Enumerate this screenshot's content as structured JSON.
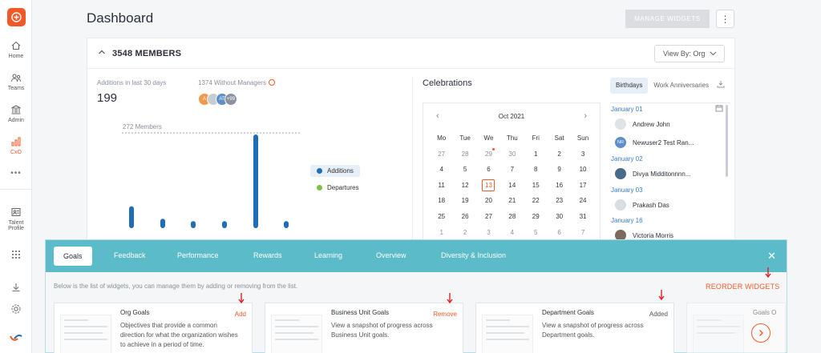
{
  "sidebar": {
    "items": [
      {
        "label": "Home",
        "icon": "home-icon"
      },
      {
        "label": "Teams",
        "icon": "teams-icon"
      },
      {
        "label": "Admin",
        "icon": "admin-icon"
      },
      {
        "label": "CxO",
        "icon": "cxo-icon"
      },
      {
        "label": "Talent Profile",
        "icon": "talent-profile-icon"
      }
    ],
    "more": "•••"
  },
  "header": {
    "title": "Dashboard",
    "manage_widgets": "MANAGE WIDGETS",
    "kebab": "⋮"
  },
  "members": {
    "title": "3548 MEMBERS",
    "view_by": "View By: Org",
    "additions_label": "Additions in last 30 days",
    "additions_value": "199",
    "without_managers": "1374 Without Managers",
    "avatars": [
      "A",
      "",
      "AT",
      "+99"
    ]
  },
  "chart_data": {
    "type": "bar",
    "reference_line_label": "272 Members",
    "series": [
      {
        "name": "Additions",
        "color": "#1f6db5",
        "values": [
          28,
          12,
          9,
          9,
          120,
          9
        ]
      },
      {
        "name": "Departures",
        "color": "#7cc244",
        "values": [
          0,
          0,
          0,
          0,
          0,
          0
        ]
      }
    ]
  },
  "celebrations": {
    "title": "Celebrations",
    "tabs": [
      "Birthdays",
      "Work Anniversaries"
    ],
    "calendar": {
      "month": "Oct 2021",
      "dow": [
        "Mo",
        "Tue",
        "We",
        "Thu",
        "Fri",
        "Sat",
        "Sun"
      ],
      "weeks": [
        [
          "27",
          "28",
          "29",
          "30",
          "1",
          "2",
          "3"
        ],
        [
          "4",
          "5",
          "6",
          "7",
          "8",
          "9",
          "10"
        ],
        [
          "11",
          "12",
          "13",
          "14",
          "15",
          "16",
          "17"
        ],
        [
          "18",
          "19",
          "20",
          "21",
          "22",
          "23",
          "24"
        ],
        [
          "25",
          "26",
          "27",
          "28",
          "29",
          "30",
          "31"
        ],
        [
          "1",
          "2",
          "3",
          "4",
          "5",
          "6",
          "7"
        ]
      ],
      "today": "13"
    },
    "birthdays": [
      {
        "date": "January 01",
        "people": [
          {
            "name": "Andrew John",
            "initials": ""
          },
          {
            "name": "Newuser2 Test Ran...",
            "initials": "NR"
          }
        ]
      },
      {
        "date": "January 02",
        "people": [
          {
            "name": "Divya Midditonnnn...",
            "initials": ""
          }
        ]
      },
      {
        "date": "January 03",
        "people": [
          {
            "name": "Prakash Das",
            "initials": ""
          }
        ]
      },
      {
        "date": "January 16",
        "people": [
          {
            "name": "Victoria Morris",
            "initials": ""
          }
        ]
      }
    ]
  },
  "widget_manager": {
    "tabs": [
      "Goals",
      "Feedback",
      "Performance",
      "Rewards",
      "Learning",
      "Overview",
      "Diversity & Inclusion"
    ],
    "close": "✕",
    "description": "Below is the list of widgets, you can manage them by adding or removing from the list.",
    "reorder": "REORDER WIDGETS",
    "cards": [
      {
        "title": "Org Goals",
        "description": "Objectives that provide a common direction for what the organization wishes to achieve in a period of time.",
        "action": "Add"
      },
      {
        "title": "Business Unit Goals",
        "description": "View a snapshot of progress across Business Unit goals.",
        "action": "Remove"
      },
      {
        "title": "Department Goals",
        "description": "View a snapshot of progress across Department goals.",
        "action": "Added"
      },
      {
        "title": "Goals O",
        "description": "",
        "action": ""
      }
    ]
  }
}
